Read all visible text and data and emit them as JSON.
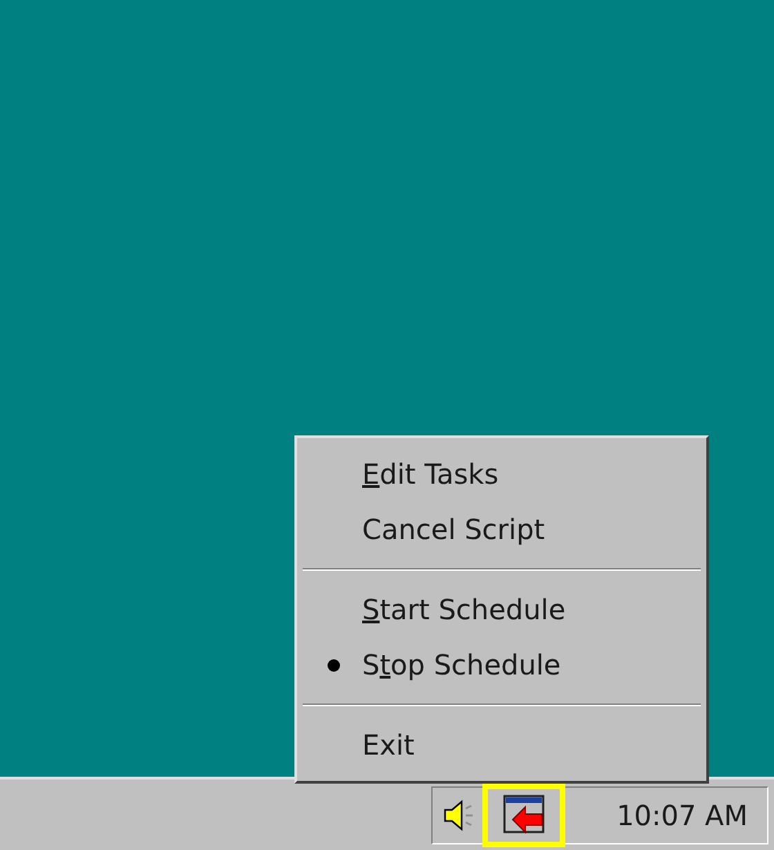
{
  "context_menu": {
    "items": [
      {
        "kind": "item",
        "mnemonic": "E",
        "text_after": "dit Tasks",
        "checked": false
      },
      {
        "kind": "item",
        "text_after": "Cancel Script",
        "checked": false
      },
      {
        "kind": "separator"
      },
      {
        "kind": "item",
        "mnemonic": "S",
        "text_after": "tart Schedule",
        "checked": false
      },
      {
        "kind": "item",
        "text_before": "S",
        "mnemonic": "t",
        "text_after": "op Schedule",
        "checked": true
      },
      {
        "kind": "separator"
      },
      {
        "kind": "item",
        "text_after": "Exit",
        "checked": false
      }
    ]
  },
  "taskbar": {
    "tray": {
      "icons": [
        {
          "kind": "speaker",
          "highlighted": false
        },
        {
          "kind": "scheduler",
          "highlighted": true
        }
      ],
      "clock": "10:07 AM"
    }
  }
}
